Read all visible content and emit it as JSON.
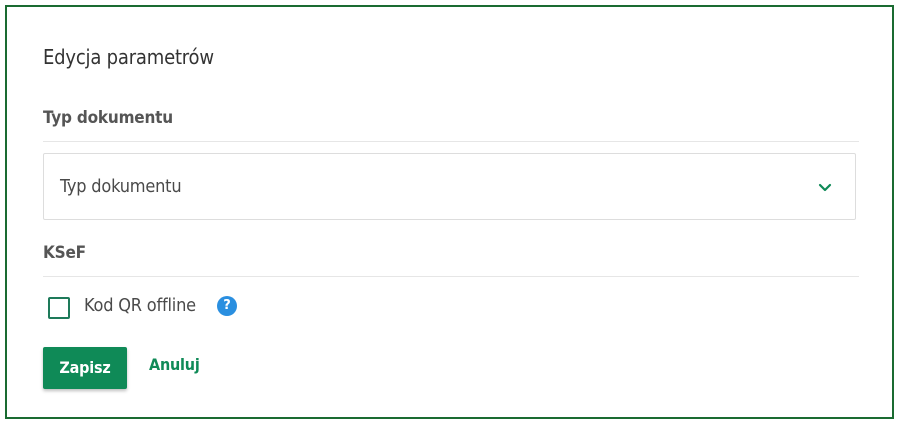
{
  "dialog": {
    "title": "Edycja parametrów"
  },
  "sections": {
    "document_type": {
      "label": "Typ dokumentu",
      "select_value": "Typ dokumentu"
    },
    "ksef": {
      "label": "KSeF",
      "checkbox_label": "Kod QR offline",
      "checkbox_checked": false,
      "help_glyph": "?"
    }
  },
  "actions": {
    "save_label": "Zapisz",
    "cancel_label": "Anuluj"
  },
  "colors": {
    "frame_border": "#1a6b31",
    "primary": "#0f8a57",
    "help_icon": "#2a8fe0"
  },
  "icons": [
    "chevron-down-icon",
    "help-icon"
  ]
}
